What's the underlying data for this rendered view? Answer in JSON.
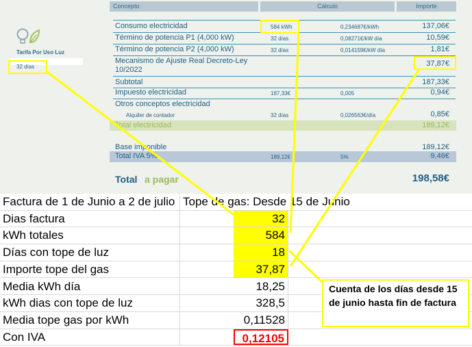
{
  "bill": {
    "headers": {
      "concepto": "Concepto",
      "calculo": "Cálculo",
      "importe": "Importe"
    },
    "tariff_name": "Tarifa Por Uso Luz",
    "days_badge": "32 días",
    "rows": {
      "consumo": {
        "label": "Consumo electricidad",
        "qty": "584 kWh",
        "rate": "0,234687€/kWh",
        "amount": "137,06€"
      },
      "p1": {
        "label": "Término de potencia P1 (4,000 kW)",
        "qty": "32 días",
        "rate": "0,08271€/kW día",
        "amount": "10,59€"
      },
      "p2": {
        "label": "Término de potencia P2 (4,000 kW)",
        "qty": "32 días",
        "rate": "0,014159€/kW día",
        "amount": "1,81€"
      },
      "ajuste": {
        "label_line1": "Mecanismo de Ajuste Real Decreto-Ley",
        "label_line2": "10/2022",
        "amount": "37,87€"
      },
      "subtotal": {
        "label": "Subtotal",
        "amount": "187,33€"
      },
      "impuesto": {
        "label": "Impuesto electricidad",
        "qty": "187,33€",
        "rate": "0,005",
        "amount": "0,94€"
      },
      "otros": {
        "label": "Otros conceptos electricidad"
      },
      "alquiler": {
        "label": "Alquiler de contador",
        "qty": "32 días",
        "rate": "0,026563€/día",
        "amount": "0,85€"
      },
      "total_elec": {
        "label": "Total electricidad",
        "amount": "189,12€"
      },
      "base": {
        "label": "Base imponible",
        "amount": "189,12€"
      },
      "iva": {
        "label": "Total IVA 5%",
        "qty": "189,12€",
        "rate": "5%",
        "amount": "9,46€"
      },
      "total": {
        "label_a": "Total",
        "label_b": "a pagar",
        "amount": "198,58€"
      }
    }
  },
  "sheet": {
    "header_left": "Factura de 1 de Junio a 2 de julio",
    "header_right": "Tope de gas: Desde 15 de Junio",
    "rows": [
      {
        "label": "Dias factura",
        "value": "32"
      },
      {
        "label": "kWh totales",
        "value": "584"
      },
      {
        "label": "Días con tope de luz",
        "value": "18"
      },
      {
        "label": "Importe tope del gas",
        "value": "37,87"
      },
      {
        "label": "Media kWh día",
        "value": "18,25"
      },
      {
        "label": "kWh dias con tope de luz",
        "value": "328,5"
      },
      {
        "label": "Media tope gas por kWh",
        "value": "0,11528"
      },
      {
        "label": "Con IVA",
        "value": "0,12105"
      }
    ],
    "note": "Cuenta de los días desde 15 de junio hasta fin de factura"
  },
  "colors": {
    "highlight": "#ffff00",
    "accent_red": "#ff0000",
    "bill_blue": "#1f5e86",
    "bill_green": "#a4c25a"
  }
}
